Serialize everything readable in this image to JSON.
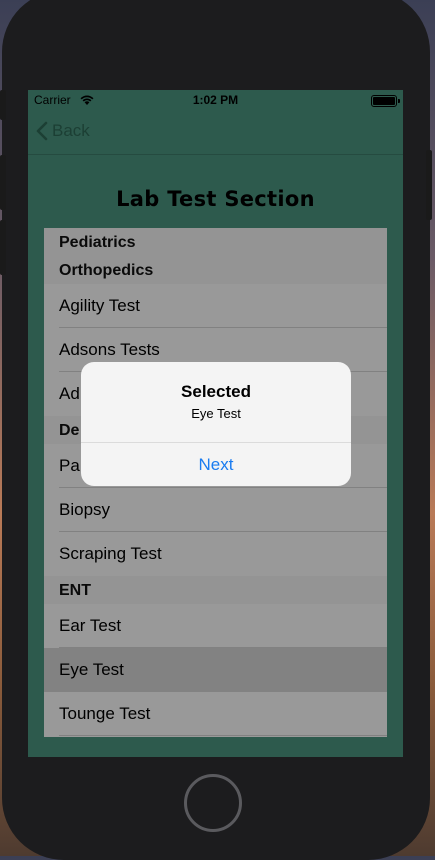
{
  "status_bar": {
    "carrier": "Carrier",
    "time": "1:02 PM"
  },
  "nav": {
    "back_label": "Back"
  },
  "page": {
    "title": "Lab Test Section"
  },
  "list": {
    "sections": [
      {
        "header": "Pediatrics",
        "rows": []
      },
      {
        "header": "Orthopedics",
        "rows": [
          "Agility Test",
          "Adsons Tests",
          "Ad"
        ]
      },
      {
        "header": "De",
        "rows": [
          "Pa",
          "Biopsy",
          "Scraping Test"
        ]
      },
      {
        "header": "ENT",
        "rows": [
          "Ear Test",
          "Eye Test",
          "Tounge Test"
        ]
      }
    ],
    "selected_row": "Eye Test"
  },
  "alert": {
    "title": "Selected",
    "message": "Eye Test",
    "button_label": "Next"
  },
  "colors": {
    "screen_bg": "#4b9780",
    "link": "#1a7cf0",
    "back_tint": "#2f6a58"
  },
  "icons": {
    "back": "chevron-left-icon",
    "wifi": "wifi-icon",
    "battery": "battery-icon"
  }
}
